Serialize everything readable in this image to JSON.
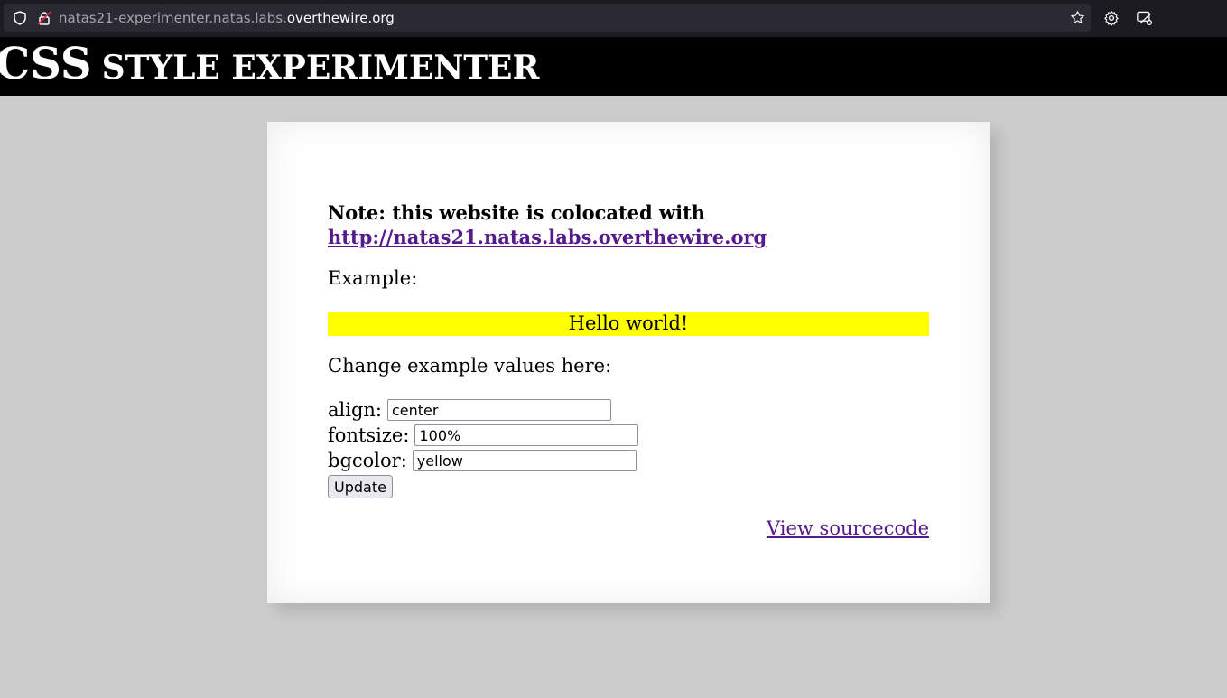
{
  "browser": {
    "url_prefix": "natas21-experimenter.natas.labs.",
    "url_domain": "overthewire.org"
  },
  "header": {
    "title_big": "CSS",
    "title_small": "STYLE EXPERIMENTER"
  },
  "main": {
    "note_text": "Note: this website is colocated with",
    "note_link": "http://natas21.natas.labs.overthewire.org",
    "example_label": "Example:",
    "hello_text": "Hello world!",
    "hello_bgcolor": "#ffff00",
    "change_label": "Change example values here:",
    "form": {
      "align_label": "align:",
      "align_value": "center",
      "fontsize_label": "fontsize:",
      "fontsize_value": "100%",
      "bgcolor_label": "bgcolor:",
      "bgcolor_value": "yellow",
      "update_label": "Update"
    },
    "source_link": "View sourcecode"
  },
  "colors": {
    "page_bg": "#cccccc",
    "header_bg": "#000000",
    "link": "#551a8b"
  },
  "icons": [
    "shield-icon",
    "lock-icon",
    "star-icon",
    "gear-icon",
    "extension-icon"
  ]
}
